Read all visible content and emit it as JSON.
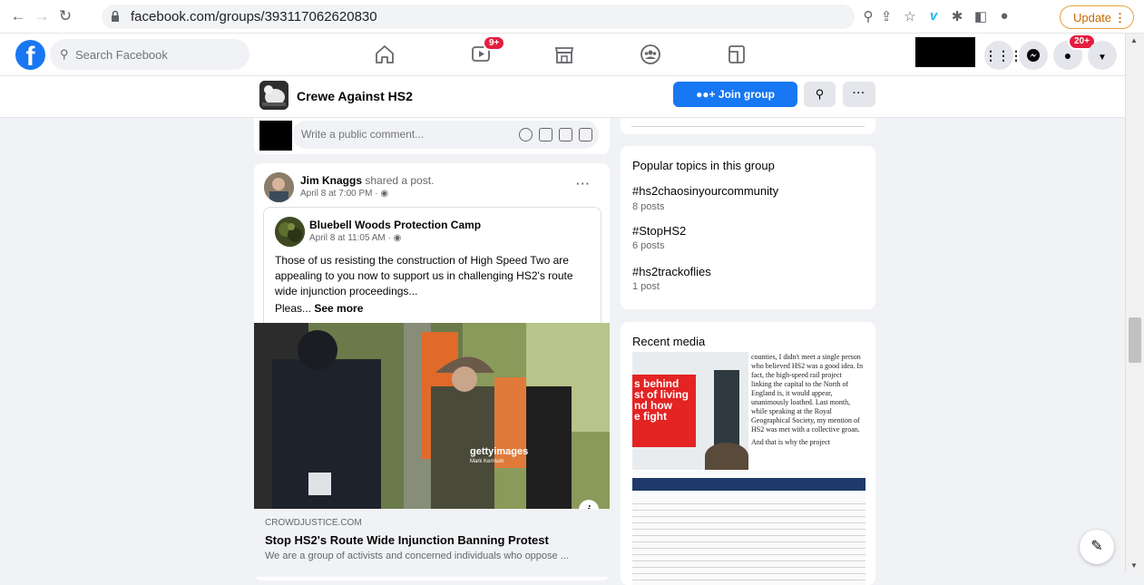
{
  "browser": {
    "url": "facebook.com/groups/393117062620830",
    "update_label": "Update"
  },
  "fb_nav": {
    "search_placeholder": "Search Facebook",
    "watch_badge": "9+",
    "notifications_badge": "20+"
  },
  "group": {
    "name": "Crewe Against HS2",
    "join_label": "Join group"
  },
  "comment": {
    "placeholder": "Write a public comment..."
  },
  "post": {
    "author": "Jim Knaggs",
    "action": " shared a post.",
    "time": "April 8 at 7:00 PM · ",
    "shared": {
      "author": "Bluebell Woods Protection Camp",
      "time": "April 8 at 11:05 AM · ",
      "text": "Those of us resisting the construction of High Speed Two are appealing to you now to support us in challenging HS2's route wide injunction proceedings...",
      "truncated": "Pleas... ",
      "see_more": "See more",
      "photo_watermark": "gettyimages",
      "photo_credit": "Mark Kerrison",
      "link_domain": "CROWDJUSTICE.COM",
      "link_title": "Stop HS2's Route Wide Injunction Banning Protest",
      "link_desc": "We are a group of activists and concerned individuals who oppose ..."
    }
  },
  "sidebar": {
    "topics_title": "Popular topics in this group",
    "topics": [
      {
        "name": "#hs2chaosinyourcommunity",
        "count": "8 posts"
      },
      {
        "name": "#StopHS2",
        "count": "6 posts"
      },
      {
        "name": "#hs2trackoflies",
        "count": "1 post"
      }
    ],
    "media_title": "Recent media",
    "media_red_text": [
      "s behind",
      "st of living",
      "nd how",
      "e fight"
    ],
    "media_article_text": "counties, I didn't meet a single person who believed HS2 was a good idea. In fact, the high-speed rail project linking the capital to the North of England is, it would appear, unanimously loathed. Last month, while speaking at the Royal Geographical Society, my mention of HS2 was met with a collective groan.",
    "media_article_text2": "And that is why the project"
  },
  "colors": {
    "fb_blue": "#1877f2",
    "badge_red": "#e41e3f",
    "bg": "#f0f2f5"
  }
}
